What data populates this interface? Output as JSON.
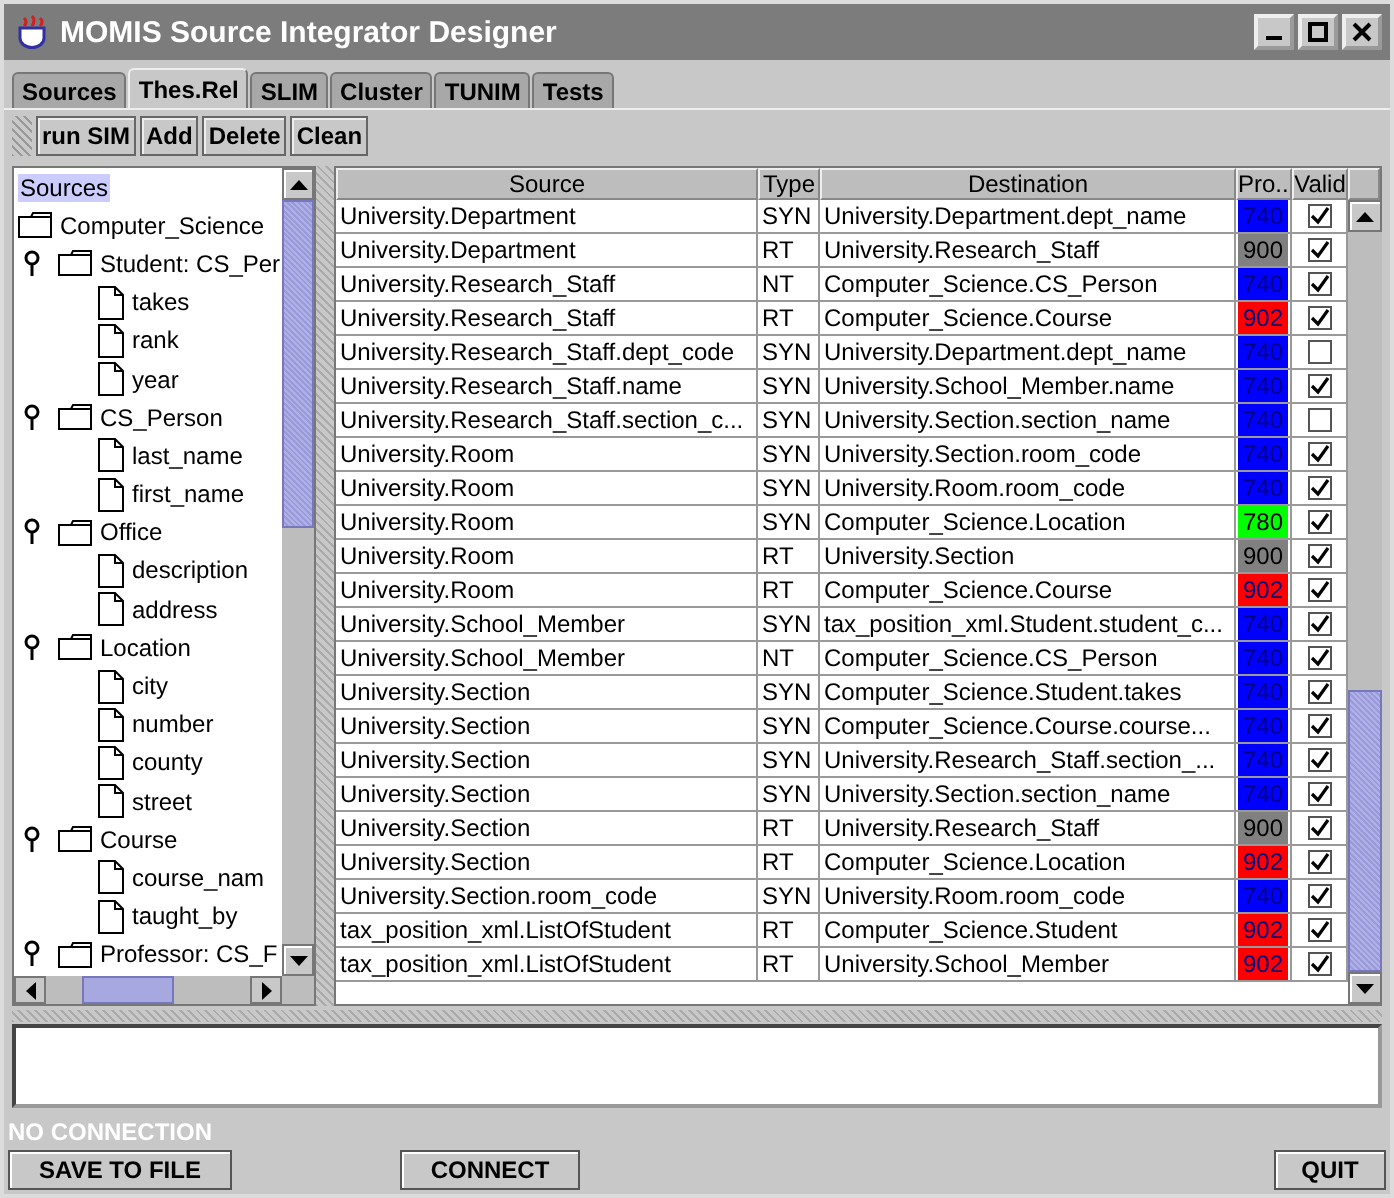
{
  "window": {
    "title": "MOMIS Source Integrator Designer"
  },
  "tabs": [
    {
      "label": "Sources",
      "selected": false
    },
    {
      "label": "Thes.Rel",
      "selected": true
    },
    {
      "label": "SLIM",
      "selected": false
    },
    {
      "label": "Cluster",
      "selected": false
    },
    {
      "label": "TUNIM",
      "selected": false
    },
    {
      "label": "Tests",
      "selected": false
    }
  ],
  "toolbar": [
    "run SIM",
    "Add",
    "Delete",
    "Clean"
  ],
  "tree": {
    "label": "Sources",
    "selected": true,
    "children": [
      {
        "label": "Computer_Science",
        "kind": "folder",
        "selected": false,
        "children": [
          {
            "label": "Student: CS_Per",
            "kind": "folder",
            "expanded": true,
            "selected": false,
            "children": [
              {
                "label": "takes",
                "kind": "leaf",
                "selected": false
              },
              {
                "label": "rank",
                "kind": "leaf",
                "selected": false
              },
              {
                "label": "year",
                "kind": "leaf",
                "selected": false
              }
            ]
          },
          {
            "label": "CS_Person",
            "kind": "folder",
            "expanded": true,
            "selected": false,
            "children": [
              {
                "label": "last_name",
                "kind": "leaf",
                "selected": false
              },
              {
                "label": "first_name",
                "kind": "leaf",
                "selected": false
              }
            ]
          },
          {
            "label": "Office",
            "kind": "folder",
            "expanded": true,
            "selected": false,
            "children": [
              {
                "label": "description",
                "kind": "leaf",
                "selected": false
              },
              {
                "label": "address",
                "kind": "leaf",
                "selected": false
              }
            ]
          },
          {
            "label": "Location",
            "kind": "folder",
            "expanded": true,
            "selected": false,
            "children": [
              {
                "label": "city",
                "kind": "leaf",
                "selected": false
              },
              {
                "label": "number",
                "kind": "leaf",
                "selected": false
              },
              {
                "label": "county",
                "kind": "leaf",
                "selected": false
              },
              {
                "label": "street",
                "kind": "leaf",
                "selected": false
              }
            ]
          },
          {
            "label": "Course",
            "kind": "folder",
            "expanded": true,
            "selected": false,
            "children": [
              {
                "label": "course_nam",
                "kind": "leaf",
                "selected": false
              },
              {
                "label": "taught_by",
                "kind": "leaf",
                "selected": false
              }
            ]
          },
          {
            "label": "Professor: CS_F",
            "kind": "folder",
            "expanded": true,
            "selected": false
          }
        ]
      }
    ]
  },
  "table": {
    "columns": [
      "Source",
      "Type",
      "Destination",
      "Pro...",
      "Valid"
    ],
    "rows": [
      {
        "source": "University.Department",
        "type": "SYN",
        "destination": "University.Department.dept_name",
        "score": "740",
        "color": "#0000ff",
        "valid": true
      },
      {
        "source": "University.Department",
        "type": "RT",
        "destination": "University.Research_Staff",
        "score": "900",
        "color": "#808080",
        "valid": true
      },
      {
        "source": "University.Research_Staff",
        "type": "NT",
        "destination": "Computer_Science.CS_Person",
        "score": "740",
        "color": "#0000ff",
        "valid": true
      },
      {
        "source": "University.Research_Staff",
        "type": "RT",
        "destination": "Computer_Science.Course",
        "score": "902",
        "color": "#ff0000",
        "valid": true
      },
      {
        "source": "University.Research_Staff.dept_code",
        "type": "SYN",
        "destination": "University.Department.dept_name",
        "score": "740",
        "color": "#0000ff",
        "valid": false
      },
      {
        "source": "University.Research_Staff.name",
        "type": "SYN",
        "destination": "University.School_Member.name",
        "score": "740",
        "color": "#0000ff",
        "valid": true
      },
      {
        "source": "University.Research_Staff.section_c...",
        "type": "SYN",
        "destination": "University.Section.section_name",
        "score": "740",
        "color": "#0000ff",
        "valid": false
      },
      {
        "source": "University.Room",
        "type": "SYN",
        "destination": "University.Section.room_code",
        "score": "740",
        "color": "#0000ff",
        "valid": true
      },
      {
        "source": "University.Room",
        "type": "SYN",
        "destination": "University.Room.room_code",
        "score": "740",
        "color": "#0000ff",
        "valid": true
      },
      {
        "source": "University.Room",
        "type": "SYN",
        "destination": "Computer_Science.Location",
        "score": "780",
        "color": "#00ff00",
        "valid": true
      },
      {
        "source": "University.Room",
        "type": "RT",
        "destination": "University.Section",
        "score": "900",
        "color": "#808080",
        "valid": true
      },
      {
        "source": "University.Room",
        "type": "RT",
        "destination": "Computer_Science.Course",
        "score": "902",
        "color": "#ff0000",
        "valid": true
      },
      {
        "source": "University.School_Member",
        "type": "SYN",
        "destination": "tax_position_xml.Student.student_c...",
        "score": "740",
        "color": "#0000ff",
        "valid": true
      },
      {
        "source": "University.School_Member",
        "type": "NT",
        "destination": "Computer_Science.CS_Person",
        "score": "740",
        "color": "#0000ff",
        "valid": true
      },
      {
        "source": "University.Section",
        "type": "SYN",
        "destination": "Computer_Science.Student.takes",
        "score": "740",
        "color": "#0000ff",
        "valid": true
      },
      {
        "source": "University.Section",
        "type": "SYN",
        "destination": "Computer_Science.Course.course...",
        "score": "740",
        "color": "#0000ff",
        "valid": true
      },
      {
        "source": "University.Section",
        "type": "SYN",
        "destination": "University.Research_Staff.section_...",
        "score": "740",
        "color": "#0000ff",
        "valid": true
      },
      {
        "source": "University.Section",
        "type": "SYN",
        "destination": "University.Section.section_name",
        "score": "740",
        "color": "#0000ff",
        "valid": true
      },
      {
        "source": "University.Section",
        "type": "RT",
        "destination": "University.Research_Staff",
        "score": "900",
        "color": "#808080",
        "valid": true
      },
      {
        "source": "University.Section",
        "type": "RT",
        "destination": "Computer_Science.Location",
        "score": "902",
        "color": "#ff0000",
        "valid": true
      },
      {
        "source": "University.Section.room_code",
        "type": "SYN",
        "destination": "University.Room.room_code",
        "score": "740",
        "color": "#0000ff",
        "valid": true
      },
      {
        "source": "tax_position_xml.ListOfStudent",
        "type": "RT",
        "destination": "Computer_Science.Student",
        "score": "902",
        "color": "#ff0000",
        "valid": true
      },
      {
        "source": "tax_position_xml.ListOfStudent",
        "type": "RT",
        "destination": "University.School_Member",
        "score": "902",
        "color": "#ff0000",
        "valid": true
      }
    ]
  },
  "status": "NO CONNECTION",
  "buttons": [
    "SAVE TO FILE",
    "CONNECT",
    "QUIT"
  ]
}
